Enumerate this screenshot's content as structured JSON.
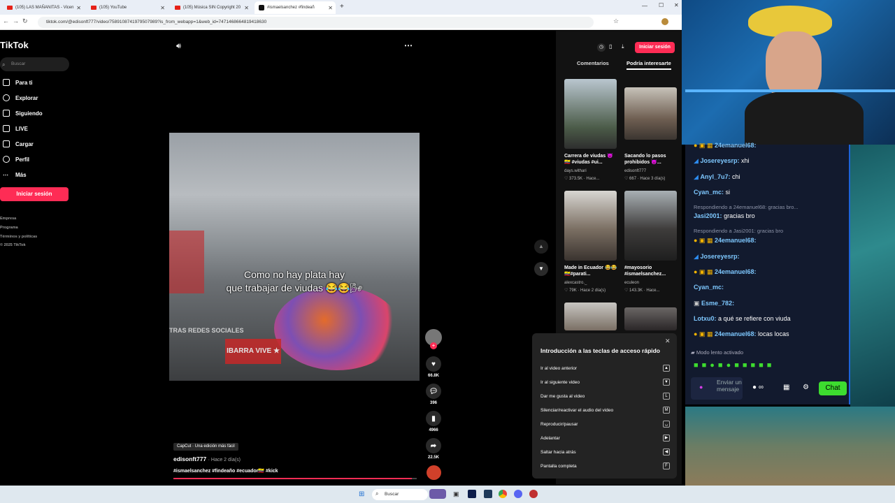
{
  "browser": {
    "tabs": [
      {
        "label": "(105) LAS MAÑANITAS - Vicen"
      },
      {
        "label": "(105) YouTube"
      },
      {
        "label": "(105) Música SIN Copyright 20"
      },
      {
        "label": "#ismaelsanchez #findeañ"
      }
    ],
    "url": "tiktok.com/@edisonft777/video/7589108741979507989?is_from_webapp=1&web_id=7471468664819418630"
  },
  "tiktok": {
    "logo": "TikTok",
    "search_placeholder": "Buscar",
    "nav": [
      "Para ti",
      "Explorar",
      "Siguiendo",
      "LIVE",
      "Cargar",
      "Perfil",
      "Más"
    ],
    "login_button": "Iniciar sesión",
    "footer": [
      "Empresa",
      "Programa",
      "Términos y políticas",
      "© 2025 TikTok"
    ]
  },
  "video": {
    "caption_line1": "Como no hay plata hay",
    "caption_line2": "que trabajar de viudas 😂😂🌬",
    "overlay_text": "TRAS REDES SOCIALES",
    "banner": "IBARRA VIVE ★",
    "capcut": "CapCut · Una edición más fácil",
    "author": "edisonft777",
    "posted": "· Hace 2 día(s)",
    "hashtags": "#ismaelsanchez #findeaño #ecuador🇪🇨 #kick",
    "progress": 0.98
  },
  "actions": {
    "likes": "66.8K",
    "comments": "396",
    "saves": "4966",
    "shares": "22.5K"
  },
  "right_panel": {
    "login_button": "Iniciar sesión",
    "tabs": [
      "Comentarios",
      "Podría interesarte"
    ],
    "videos": [
      {
        "title": "Carrera de viudas 😈🇪🇨 #viudas #ui...",
        "author": "days.withari",
        "meta": "♡ 373.5K · Hace..."
      },
      {
        "title": "Sacando lo pasos prohibidos 😈...",
        "author": "edisonft777",
        "meta": "♡ 667 · Hace 3 día(s)"
      },
      {
        "title": "Made in Ecuador 😂😂 🇪🇨#parati...",
        "author": "alexcastro._",
        "meta": "♡ 79K · Hace 2 día(s)"
      },
      {
        "title": "#mayosorio #ismaelsanchez...",
        "author": "eculeon",
        "meta": "♡ 143.3K · Hace..."
      }
    ]
  },
  "shortcuts": {
    "title": "Introducción a las teclas de acceso rápido",
    "items": [
      {
        "label": "Ir al video anterior",
        "key": "▲"
      },
      {
        "label": "Ir al siguiente video",
        "key": "▼"
      },
      {
        "label": "Dar me gusta al video",
        "key": "L"
      },
      {
        "label": "Silenciar/reactivar el audio del video",
        "key": "M"
      },
      {
        "label": "Reproducir/pausar",
        "key": "␣"
      },
      {
        "label": "Adelantar",
        "key": "▶"
      },
      {
        "label": "Saltar hacia atrás",
        "key": "◀"
      },
      {
        "label": "Pantalla completa",
        "key": "F"
      }
    ]
  },
  "stream_chat": {
    "messages": [
      {
        "user": "24emanuel68:",
        "text": ""
      },
      {
        "user": "Josereyesrp:",
        "text": "xhi"
      },
      {
        "user": "Anyl_7u7:",
        "text": "chi"
      },
      {
        "user": "Cyan_mc:",
        "text": "si"
      },
      {
        "reply": "Respondiendo a 24emanuel68: gracias bro..."
      },
      {
        "user": "Jasi2001:",
        "text": "gracias bro"
      },
      {
        "reply": "Respondiendo a Jasi2001: gracias bro"
      },
      {
        "user": "24emanuel68:",
        "text": ""
      },
      {
        "user": "Josereyesrp:",
        "text": ""
      },
      {
        "user": "24emanuel68:",
        "text": ""
      },
      {
        "user": "Cyan_mc:",
        "text": ""
      },
      {
        "user": "Esme_782:",
        "text": ""
      },
      {
        "user": "Lotxu0:",
        "text": "a qué se refiere con viuda"
      },
      {
        "user": "24emanuel68:",
        "text": "locas locas"
      }
    ],
    "slow_mode": "Modo lento activado",
    "input_placeholder": "Enviar un mensaje",
    "chat_button": "Chat"
  },
  "taskbar": {
    "search": "Buscar"
  },
  "colors": {
    "tiktok_red": "#fe2c55",
    "chat_green": "#3ddc2f",
    "chat_bg": "#121a2e"
  }
}
